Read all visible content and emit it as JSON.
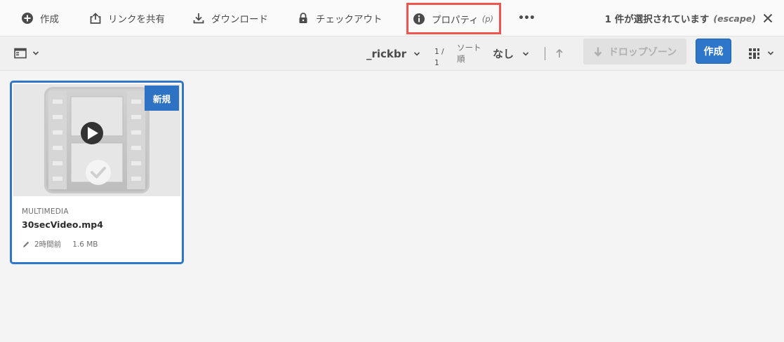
{
  "actionbar": {
    "create_label": "作成",
    "share_link_label": "リンクを共有",
    "download_label": "ダウンロード",
    "checkout_label": "チェックアウト",
    "properties_label": "プロパティ",
    "properties_shortcut": "(p)",
    "more_label": "•••",
    "selection_text": "1 件が選択されています",
    "selection_shortcut": "(escape)"
  },
  "toolbar": {
    "user_name": "_rickbr",
    "pager_line1": "1 /",
    "pager_line2": "1",
    "sort_label_line1": "ソート",
    "sort_label_line2": "順",
    "sort_value": "なし",
    "dropzone_label": "ドロップゾーン",
    "create_button_label": "作成"
  },
  "card": {
    "badge": "新規",
    "type": "MULTIMEDIA",
    "title": "30secVideo.mp4",
    "modified": "2時間前",
    "size": "1.6 MB"
  },
  "colors": {
    "accent": "#2d76c9",
    "highlight": "#f0544f"
  },
  "icons": {
    "create": "add-circle-icon",
    "share": "share-icon",
    "download": "download-icon",
    "checkout": "lock-icon",
    "properties": "info-icon",
    "close": "close-icon"
  }
}
